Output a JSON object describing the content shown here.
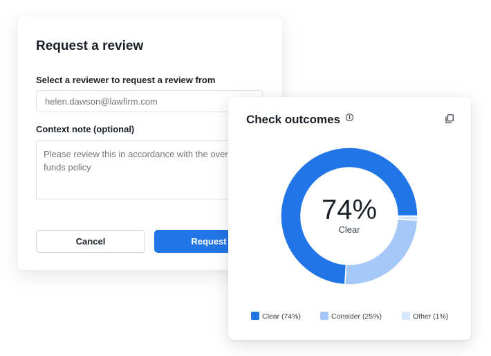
{
  "review": {
    "title": "Request a review",
    "reviewer_label": "Select a reviewer to request a review from",
    "reviewer_placeholder": "helen.dawson@lawfirm.com",
    "context_label": "Context note (optional)",
    "context_placeholder": "Please review this in accordance with the overseas funds policy",
    "cancel_label": "Cancel",
    "request_label": "Request"
  },
  "outcomes": {
    "title": "Check outcomes",
    "info_icon": "info-icon",
    "copy_icon": "copy-icon",
    "center_value": "74%",
    "center_label": "Clear"
  },
  "chart_data": {
    "type": "pie",
    "title": "Check outcomes",
    "categories": [
      "Clear",
      "Consider",
      "Other"
    ],
    "values": [
      74,
      25,
      1
    ],
    "legend_labels": [
      "Clear (74%)",
      "Consider (25%)",
      "Other (1%)"
    ],
    "colors": [
      "#2175e6",
      "#a5c8f8",
      "#d6e6fb"
    ],
    "legend": "bottom"
  },
  "colors": {
    "accent": "#2175e6",
    "consider": "#a5c8f8",
    "other": "#d6e6fb"
  }
}
